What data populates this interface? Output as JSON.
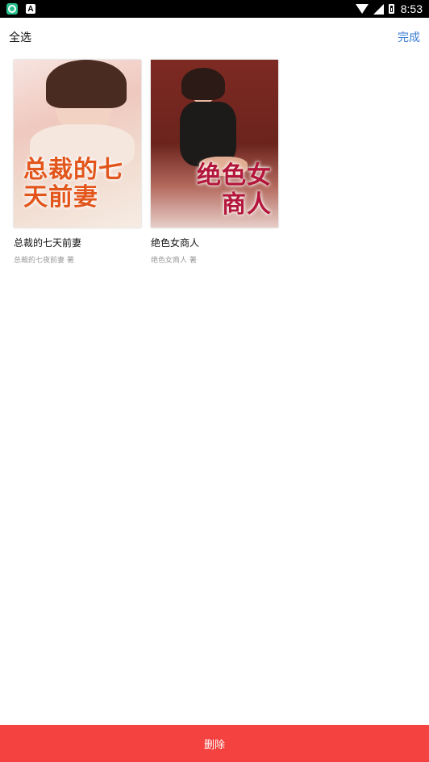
{
  "status_bar": {
    "time": "8:53"
  },
  "header": {
    "select_all": "全选",
    "done": "完成"
  },
  "books": [
    {
      "title": "总裁的七天前妻",
      "author": "总裁的七夜前妻 著",
      "cover_text": "总裁的七天前妻"
    },
    {
      "title": "绝色女商人",
      "author": "绝色女商人 著",
      "cover_text": "绝色女商人"
    }
  ],
  "footer": {
    "delete_label": "删除"
  },
  "colors": {
    "accent": "#3a7bd5",
    "delete_bar": "#f44240"
  }
}
